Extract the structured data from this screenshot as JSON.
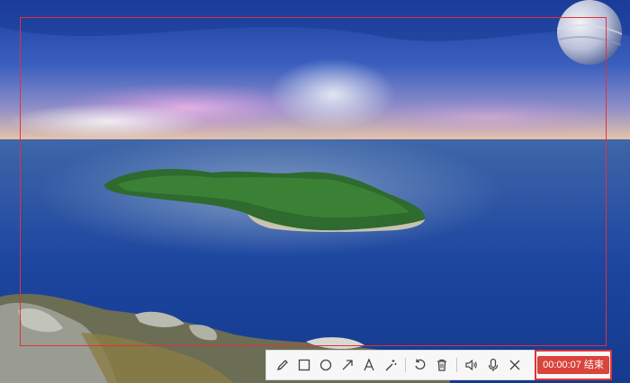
{
  "toolbar": {
    "tools": [
      {
        "name": "pencil-icon"
      },
      {
        "name": "rectangle-icon"
      },
      {
        "name": "circle-icon"
      },
      {
        "name": "arrow-icon"
      },
      {
        "name": "text-icon"
      },
      {
        "name": "magic-wand-icon"
      },
      {
        "name": "undo-icon"
      },
      {
        "name": "trash-icon"
      },
      {
        "name": "speaker-icon"
      },
      {
        "name": "microphone-icon"
      },
      {
        "name": "close-icon"
      }
    ]
  },
  "recording": {
    "elapsed": "00:00:07",
    "end_label": "结束"
  },
  "colors": {
    "accent": "#e0323a",
    "end_button": "#d9443b",
    "icon": "#444444"
  }
}
